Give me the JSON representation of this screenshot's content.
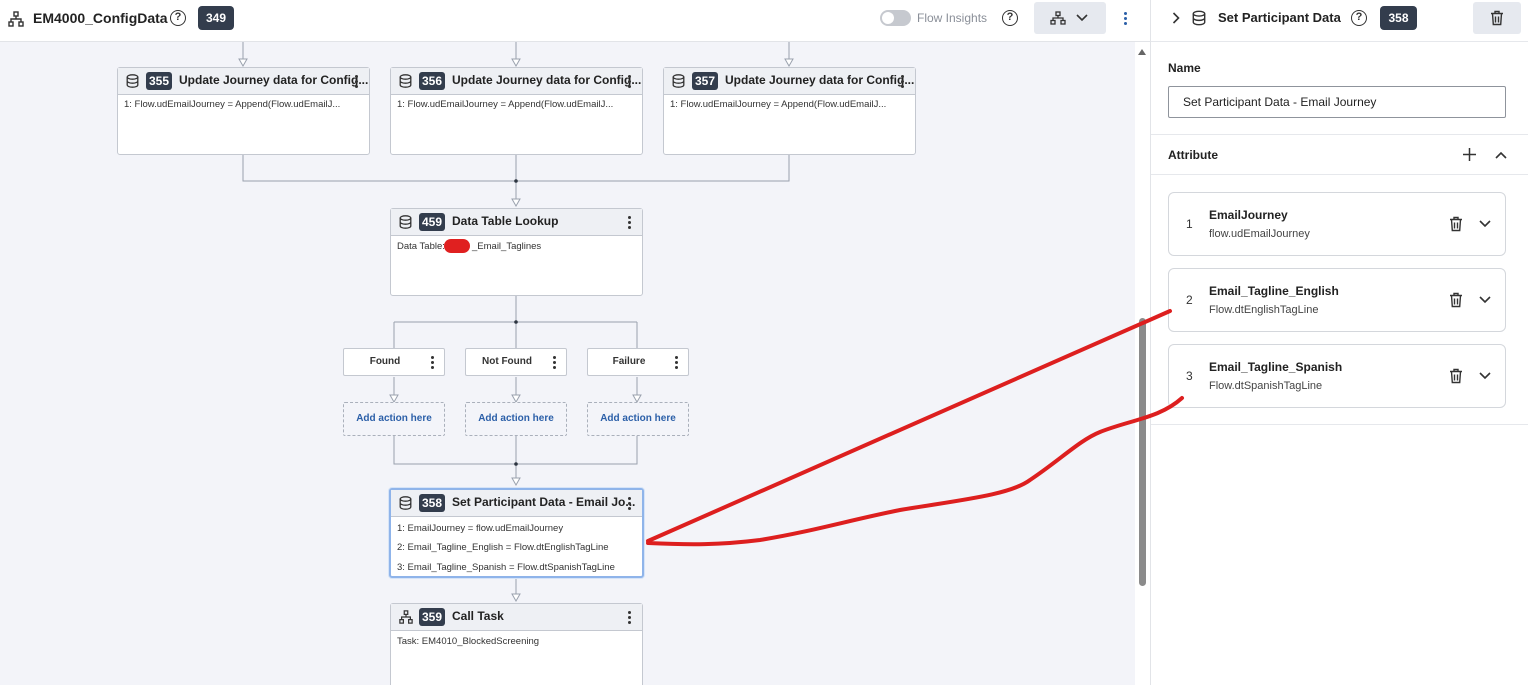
{
  "topbar": {
    "flow_title": "EM4000_ConfigData",
    "flow_badge": "349",
    "flow_insights_label": "Flow Insights",
    "help_glyph": "?"
  },
  "canvas": {
    "nodes": [
      {
        "id": "355",
        "title": "Update Journey data for Config...",
        "icon": "database-icon",
        "lines": [
          "1: Flow.udEmailJourney = Append(Flow.udEmailJ..."
        ]
      },
      {
        "id": "356",
        "title": "Update Journey data for Config...",
        "icon": "database-icon",
        "lines": [
          "1: Flow.udEmailJourney = Append(Flow.udEmailJ..."
        ]
      },
      {
        "id": "357",
        "title": "Update Journey data for Config...",
        "icon": "database-icon",
        "lines": [
          "1: Flow.udEmailJourney = Append(Flow.udEmailJ..."
        ]
      },
      {
        "id": "459",
        "title": "Data Table Lookup",
        "icon": "database-icon",
        "lines": [
          "Data Table:",
          "_Email_Taglines"
        ]
      },
      {
        "id": "358",
        "title": "Set Participant Data - Email Jo...",
        "icon": "database-icon",
        "lines": [
          "1: EmailJourney = flow.udEmailJourney",
          "2: Email_Tagline_English = Flow.dtEnglishTagLine",
          "3: Email_Tagline_Spanish = Flow.dtSpanishTagLine"
        ]
      },
      {
        "id": "359",
        "title": "Call Task",
        "icon": "flow-task-icon",
        "lines": [
          "Task: EM4010_BlockedScreening"
        ]
      }
    ],
    "outcomes": [
      "Found",
      "Not Found",
      "Failure"
    ],
    "add_action_label": "Add action here"
  },
  "panel": {
    "title": "Set Participant Data",
    "badge": "358",
    "name_label": "Name",
    "name_value": "Set Participant Data - Email Journey",
    "attribute_label": "Attribute",
    "attributes": [
      {
        "num": "1",
        "name": "EmailJourney",
        "value": "flow.udEmailJourney"
      },
      {
        "num": "2",
        "name": "Email_Tagline_English",
        "value": "Flow.dtEnglishTagLine"
      },
      {
        "num": "3",
        "name": "Email_Tagline_Spanish",
        "value": "Flow.dtSpanishTagLine"
      }
    ]
  },
  "colors": {
    "badge_bg": "#333d4d",
    "canvas_bg": "#f3f4f9",
    "link_blue": "#2b5fa8",
    "selected_border": "#8fb4ea",
    "annotation_red": "#dd1f1f"
  }
}
